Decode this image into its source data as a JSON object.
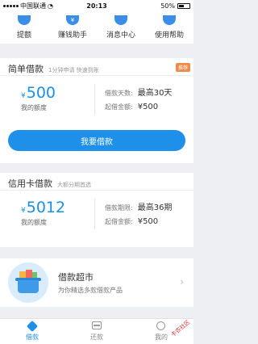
{
  "status_bar": {
    "carrier": "中国联通",
    "time": "20:13",
    "battery": "50%"
  },
  "top_nav": [
    {
      "label": "提额",
      "icon": "withdraw-icon"
    },
    {
      "label": "赚钱助手",
      "icon": "money-bag-icon"
    },
    {
      "label": "消息中心",
      "icon": "bell-icon"
    },
    {
      "label": "使用帮助",
      "icon": "help-icon"
    }
  ],
  "simple_loan": {
    "title": "简单借款",
    "subtitle": "1分钟申请 快速到账",
    "badge": "推荐",
    "currency": "¥",
    "amount": "500",
    "amount_caption": "我的额度",
    "days_label": "借款天数:",
    "days_value": "最高30天",
    "min_label": "起借金额:",
    "min_value": "¥500",
    "button": "我要借款"
  },
  "credit_loan": {
    "title": "信用卡借款",
    "subtitle": "大额分期首选",
    "currency": "¥",
    "amount": "5012",
    "amount_caption": "我的额度",
    "period_label": "借款期限:",
    "period_value": "最高36期",
    "min_label": "起借金额:",
    "min_value": "¥500"
  },
  "market": {
    "title": "借款超市",
    "subtitle": "为你精选多款借款产品",
    "arrow": "›"
  },
  "tabs": [
    {
      "label": "借款",
      "active": true,
      "icon": "loan-diamond-icon"
    },
    {
      "label": "还款",
      "active": false,
      "icon": "repay-card-icon"
    },
    {
      "label": "我的",
      "active": false,
      "icon": "profile-icon"
    }
  ],
  "watermark": "卡农社区",
  "colors": {
    "accent": "#1e90ea",
    "badge": "#f08a4b",
    "background": "#eeeff3"
  }
}
